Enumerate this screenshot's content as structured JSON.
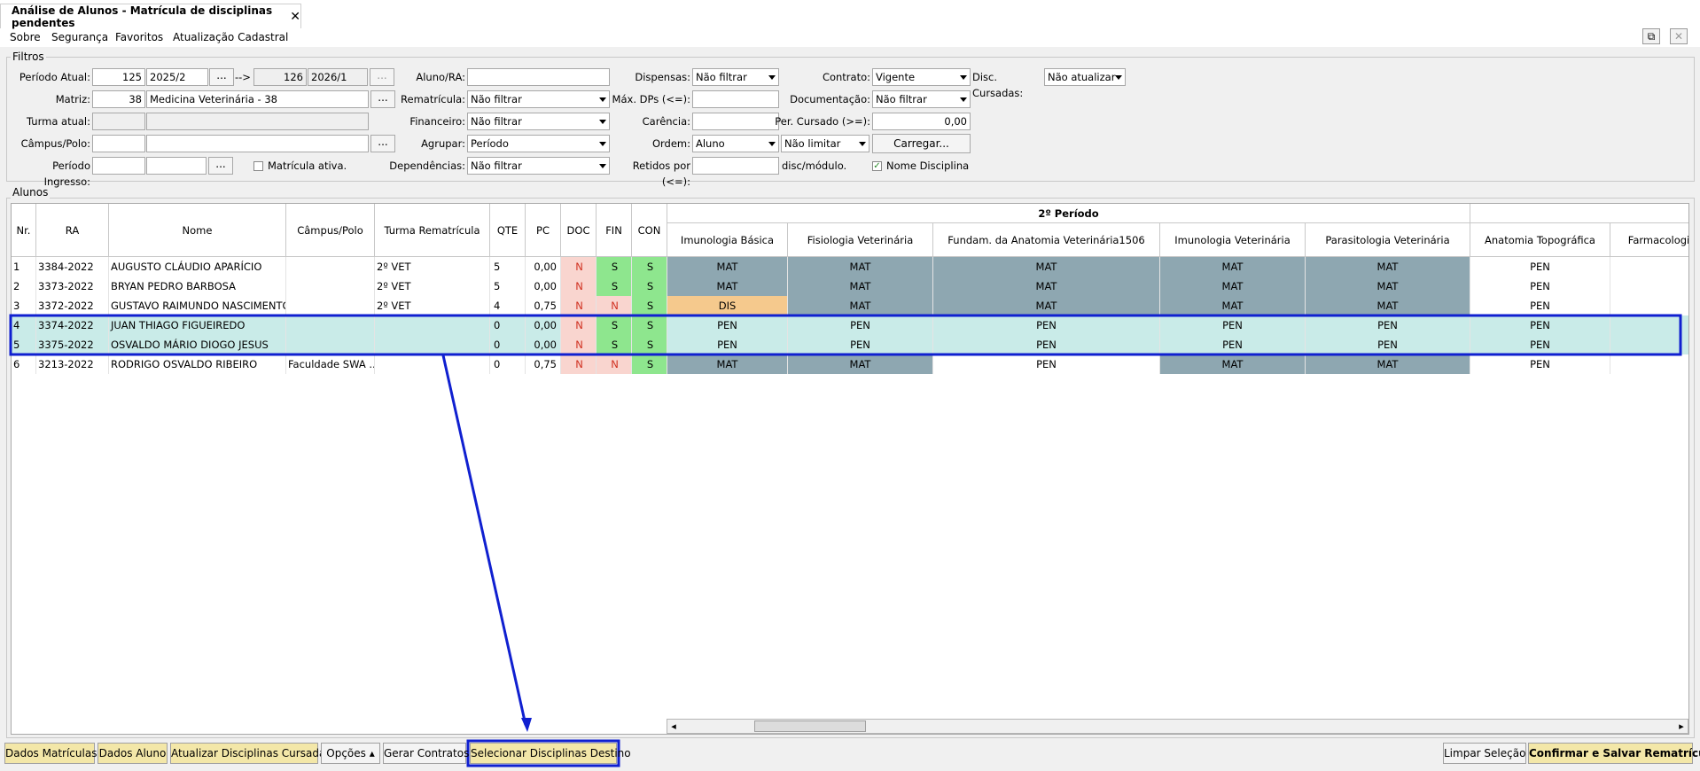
{
  "tab": {
    "title": "Análise de Alunos - Matrícula de disciplinas pendentes",
    "close": "✕"
  },
  "menu": [
    "Sobre",
    "Segurança",
    "Favoritos",
    "Atualização Cadastral"
  ],
  "window_buttons": {
    "popout": "⧉",
    "close": "✕"
  },
  "filters": {
    "legend": "Filtros",
    "periodo_atual": {
      "label": "Período Atual:",
      "code_from": "125",
      "period_from": "2025/2",
      "arrow": "-->",
      "code_to": "126",
      "period_to": "2026/1"
    },
    "matriz": {
      "label": "Matriz:",
      "code": "38",
      "name": "Medicina Veterinária - 38"
    },
    "turma_atual": {
      "label": "Turma atual:",
      "code": "",
      "name": ""
    },
    "campus": {
      "label": "Câmpus/Polo:",
      "code": "",
      "name": ""
    },
    "periodo_ingresso": {
      "label": "Período Ingresso:",
      "code": "",
      "name": ""
    },
    "matricula_ativa": {
      "label": "Matrícula ativa.",
      "checked": false
    },
    "aluno_ra": {
      "label": "Aluno/RA:",
      "value": ""
    },
    "rematricula": {
      "label": "Rematrícula:",
      "value": "Não filtrar"
    },
    "financeiro": {
      "label": "Financeiro:",
      "value": "Não filtrar"
    },
    "agrupar": {
      "label": "Agrupar:",
      "value": "Período"
    },
    "dependencias": {
      "label": "Dependências:",
      "value": "Não filtrar"
    },
    "dispensas": {
      "label": "Dispensas:",
      "value": "Não filtrar"
    },
    "max_dps": {
      "label": "Máx. DPs (<=):",
      "value": ""
    },
    "carencia": {
      "label": "Carência:",
      "value": ""
    },
    "ordem": {
      "label": "Ordem:",
      "value": "Aluno",
      "limit": "Não limitar"
    },
    "retidos": {
      "label": "Retidos por (<=):",
      "value": "",
      "unit": "disc/módulo."
    },
    "contrato": {
      "label": "Contrato:",
      "value": "Vigente"
    },
    "documentacao": {
      "label": "Documentação:",
      "value": "Não filtrar"
    },
    "per_cursado": {
      "label": "Per. Cursado (>=):",
      "value": "0,00"
    },
    "carregar": "Carregar...",
    "nome_disciplina": {
      "label": "Nome Disciplina",
      "checked": true
    },
    "disc_cursadas": {
      "label": "Disc. Cursadas:",
      "value": "Não atualizar"
    },
    "ellipsis": "...",
    "check_mark": "✓"
  },
  "alunos": {
    "legend": "Alunos",
    "group_header": "2º Período",
    "columns": [
      "Nr.",
      "RA",
      "Nome",
      "Câmpus/Polo",
      "Turma Rematrícula",
      "QTE",
      "PC",
      "DOC",
      "FIN",
      "CON"
    ],
    "disciplinas": [
      "Imunologia Básica",
      "Fisiologia Veterinária",
      "Fundam. da Anatomia Veterinária1506",
      "Imunologia Veterinária",
      "Parasitologia Veterinária",
      "Anatomia Topográfica",
      "Farmacologi"
    ],
    "rows": [
      {
        "nr": "1",
        "ra": "3384-2022",
        "nome": "AUGUSTO CLÁUDIO APARÍCIO",
        "campus": "",
        "turma": "2º VET",
        "qte": "5",
        "pc": "0,00",
        "doc": "N",
        "fin": "S",
        "con": "S",
        "disc": [
          "MAT",
          "MAT",
          "MAT",
          "MAT",
          "MAT",
          "PEN"
        ],
        "selected": false
      },
      {
        "nr": "2",
        "ra": "3373-2022",
        "nome": "BRYAN PEDRO BARBOSA",
        "campus": "",
        "turma": "2º VET",
        "qte": "5",
        "pc": "0,00",
        "doc": "N",
        "fin": "S",
        "con": "S",
        "disc": [
          "MAT",
          "MAT",
          "MAT",
          "MAT",
          "MAT",
          "PEN"
        ],
        "selected": false
      },
      {
        "nr": "3",
        "ra": "3372-2022",
        "nome": "GUSTAVO RAIMUNDO NASCIMENTO",
        "campus": "",
        "turma": "2º VET",
        "qte": "4",
        "pc": "0,75",
        "doc": "N",
        "fin": "N",
        "con": "S",
        "disc": [
          "DIS",
          "MAT",
          "MAT",
          "MAT",
          "MAT",
          "PEN"
        ],
        "selected": false
      },
      {
        "nr": "4",
        "ra": "3374-2022",
        "nome": "JUAN THIAGO FIGUEIREDO",
        "campus": "",
        "turma": "",
        "qte": "0",
        "pc": "0,00",
        "doc": "N",
        "fin": "S",
        "con": "S",
        "disc": [
          "PEN",
          "PEN",
          "PEN",
          "PEN",
          "PEN",
          "PEN"
        ],
        "selected": true
      },
      {
        "nr": "5",
        "ra": "3375-2022",
        "nome": "OSVALDO MÁRIO DIOGO JESUS",
        "campus": "",
        "turma": "",
        "qte": "0",
        "pc": "0,00",
        "doc": "N",
        "fin": "S",
        "con": "S",
        "disc": [
          "PEN",
          "PEN",
          "PEN",
          "PEN",
          "PEN",
          "PEN"
        ],
        "selected": true
      },
      {
        "nr": "6",
        "ra": "3213-2022",
        "nome": "RODRIGO OSVALDO RIBEIRO",
        "campus": "Faculdade SWA ...",
        "turma": "",
        "qte": "0",
        "pc": "0,75",
        "doc": "N",
        "fin": "N",
        "con": "S",
        "disc": [
          "MAT",
          "MAT",
          "PEN",
          "MAT",
          "MAT",
          "PEN"
        ],
        "selected": false
      }
    ]
  },
  "bottom_buttons": [
    "Dados Matrículas",
    "Dados Aluno",
    "Atualizar Disciplinas Cursadas",
    "Opções ▴",
    "Gerar Contratos",
    "Selecionar Disciplinas Destino"
  ],
  "right_buttons": [
    "Limpar Seleção",
    "Confirmar e Salvar Rematrículas"
  ],
  "scroll_arrows": {
    "left": "◂",
    "right": "▸"
  },
  "colors": {
    "mat": "#8ea7b1",
    "dis": "#f5c98d",
    "pen": "#ffffff",
    "doc_n": "#f9d5cf",
    "s": "#8ee68e",
    "n": "#f9d5cf",
    "selected_row": "#c9ebe8",
    "annotation": "#1020d0",
    "yellow_button": "#f3e7a8"
  }
}
